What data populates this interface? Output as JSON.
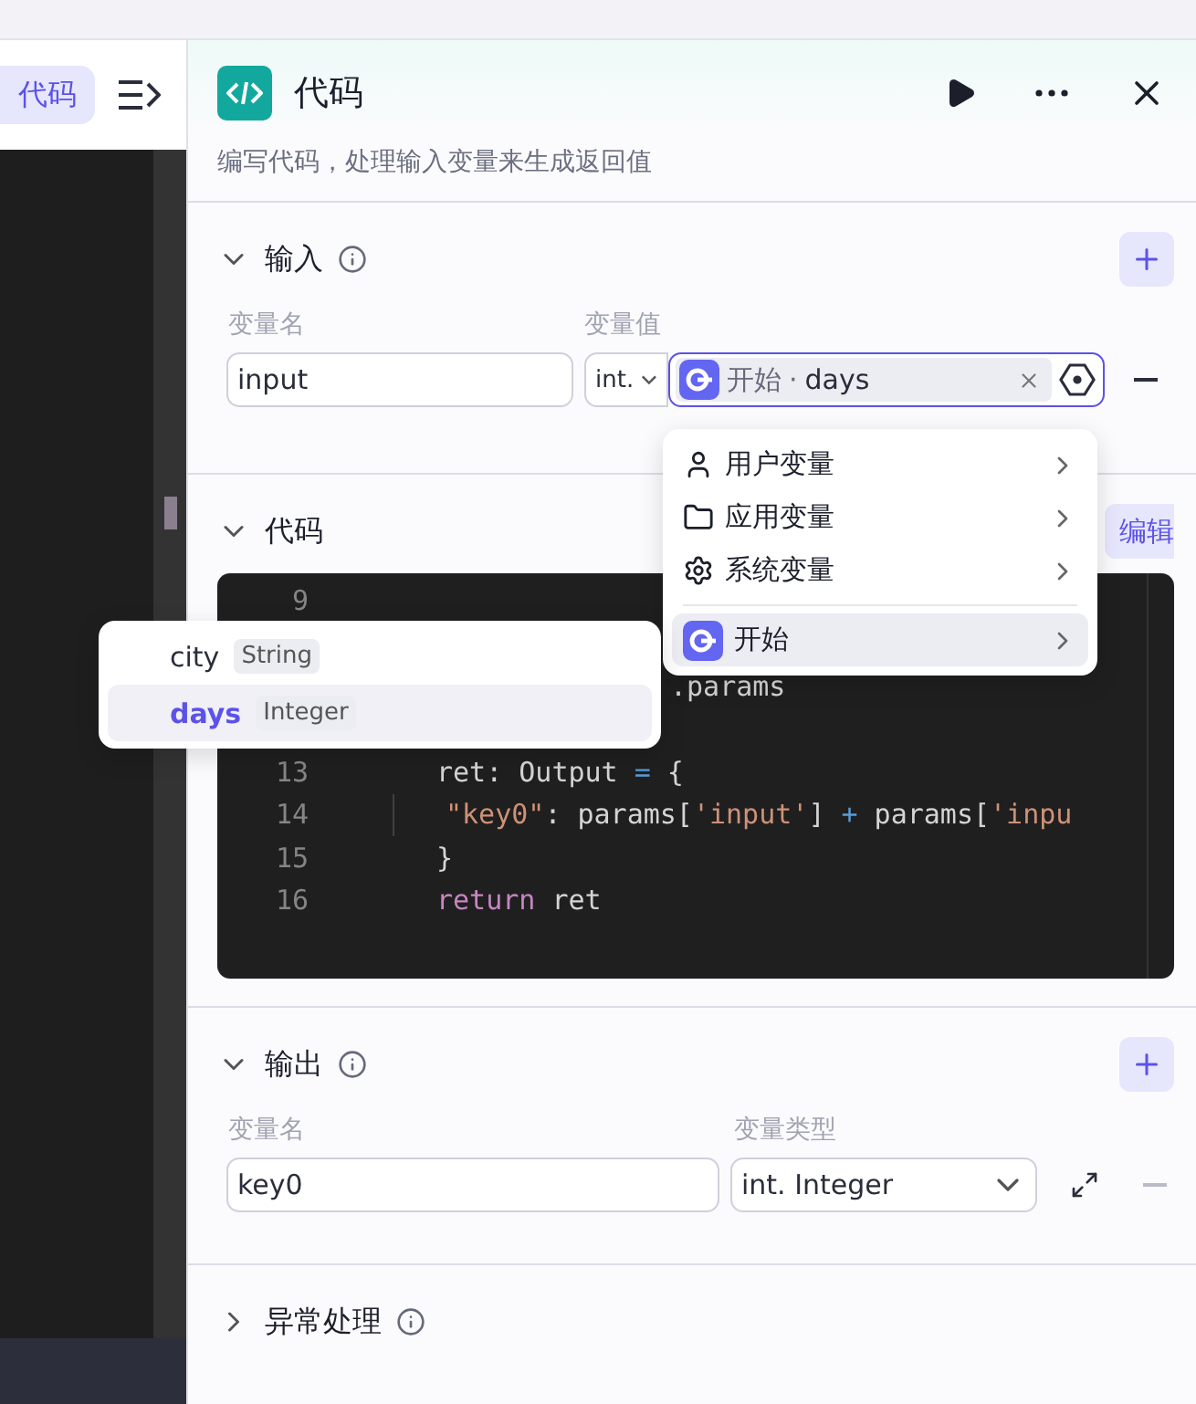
{
  "left_pane": {
    "test_button": "代码"
  },
  "node": {
    "title": "代码",
    "description": "编写代码，处理输入变量来生成返回值"
  },
  "input_section": {
    "title": "输入",
    "expanded": true,
    "name_label": "变量名",
    "value_label": "变量值",
    "row": {
      "name": "input",
      "type": "int.",
      "ref_node": "开始",
      "ref_separator": "·",
      "ref_variable": "days",
      "focused": true
    }
  },
  "code_section": {
    "title": "代码",
    "edit_button": "编辑",
    "lines": [
      {
        "kind": "numbered",
        "number": "9"
      },
      {
        "kind": "covered"
      },
      {
        "kind": "partial",
        "tokens": [
          {
            "kind": "plain",
            "text": ".params"
          }
        ]
      },
      {
        "kind": "covered"
      },
      {
        "kind": "numbered",
        "number": "13",
        "tokens": [
          {
            "kind": "plain",
            "text": "ret: Output "
          },
          {
            "kind": "operator",
            "text": "="
          },
          {
            "kind": "plain",
            "text": " {"
          }
        ]
      },
      {
        "kind": "numbered",
        "number": "14",
        "indented": true,
        "tokens": [
          {
            "kind": "string",
            "text": "\"key0\""
          },
          {
            "kind": "plain",
            "text": ": params["
          },
          {
            "kind": "string",
            "text": "'input'"
          },
          {
            "kind": "plain",
            "text": "] "
          },
          {
            "kind": "operator",
            "text": "+"
          },
          {
            "kind": "plain",
            "text": " params["
          },
          {
            "kind": "string",
            "text": "'inpu"
          }
        ]
      },
      {
        "kind": "numbered",
        "number": "15",
        "tokens": [
          {
            "kind": "plain",
            "text": "}"
          }
        ]
      },
      {
        "kind": "numbered",
        "number": "16",
        "tokens": [
          {
            "kind": "keyword",
            "text": "return"
          },
          {
            "kind": "plain",
            "text": " ret"
          }
        ]
      }
    ]
  },
  "output_section": {
    "title": "输出",
    "expanded": true,
    "name_label": "变量名",
    "type_label": "变量类型",
    "row": {
      "name": "key0",
      "type": "int. Integer"
    }
  },
  "error_section": {
    "title": "异常处理",
    "expanded": false
  },
  "variable_menu": {
    "items": [
      {
        "kind": "user",
        "label": "用户变量",
        "selected": false
      },
      {
        "kind": "app",
        "label": "应用变量",
        "selected": false
      },
      {
        "kind": "system",
        "label": "系统变量",
        "selected": false
      },
      {
        "kind": "node",
        "label": "开始",
        "selected": true
      }
    ]
  },
  "variable_submenu": {
    "items": [
      {
        "name": "city",
        "type": "String",
        "selected": false
      },
      {
        "name": "days",
        "type": "Integer",
        "selected": true
      }
    ]
  }
}
